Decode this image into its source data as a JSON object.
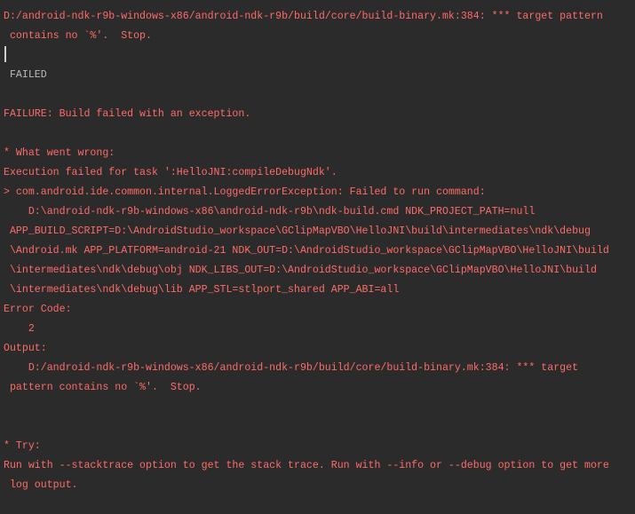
{
  "console": {
    "colors": {
      "background": "#2b2b2b",
      "error": "#ff6b68",
      "output": "#bbbbbb"
    },
    "lines": [
      {
        "text": "D:/android-ndk-r9b-windows-x86/android-ndk-r9b/build/core/build-binary.mk:384: *** target pattern",
        "kind": "err"
      },
      {
        "text": " contains no `%'.  Stop.",
        "kind": "err"
      },
      {
        "text": " FAILED",
        "kind": "out"
      },
      {
        "text": "FAILURE: Build failed with an exception.",
        "kind": "err"
      },
      {
        "text": "* What went wrong:",
        "kind": "err"
      },
      {
        "text": "Execution failed for task ':HelloJNI:compileDebugNdk'.",
        "kind": "err"
      },
      {
        "text": "> com.android.ide.common.internal.LoggedErrorException: Failed to run command:",
        "kind": "err"
      },
      {
        "text": "    D:\\android-ndk-r9b-windows-x86\\android-ndk-r9b\\ndk-build.cmd NDK_PROJECT_PATH=null",
        "kind": "err"
      },
      {
        "text": " APP_BUILD_SCRIPT=D:\\AndroidStudio_workspace\\GClipMapVBO\\HelloJNI\\build\\intermediates\\ndk\\debug",
        "kind": "err"
      },
      {
        "text": " \\Android.mk APP_PLATFORM=android-21 NDK_OUT=D:\\AndroidStudio_workspace\\GClipMapVBO\\HelloJNI\\build",
        "kind": "err"
      },
      {
        "text": " \\intermediates\\ndk\\debug\\obj NDK_LIBS_OUT=D:\\AndroidStudio_workspace\\GClipMapVBO\\HelloJNI\\build",
        "kind": "err"
      },
      {
        "text": " \\intermediates\\ndk\\debug\\lib APP_STL=stlport_shared APP_ABI=all",
        "kind": "err"
      },
      {
        "text": "Error Code:",
        "kind": "err"
      },
      {
        "text": "    2",
        "kind": "err"
      },
      {
        "text": "Output:",
        "kind": "err"
      },
      {
        "text": "    D:/android-ndk-r9b-windows-x86/android-ndk-r9b/build/core/build-binary.mk:384: *** target",
        "kind": "err"
      },
      {
        "text": " pattern contains no `%'.  Stop.",
        "kind": "err"
      },
      {
        "text": "* Try:",
        "kind": "err"
      },
      {
        "text": "Run with --stacktrace option to get the stack trace. Run with --info or --debug option to get more",
        "kind": "err"
      },
      {
        "text": " log output.",
        "kind": "err"
      }
    ]
  }
}
